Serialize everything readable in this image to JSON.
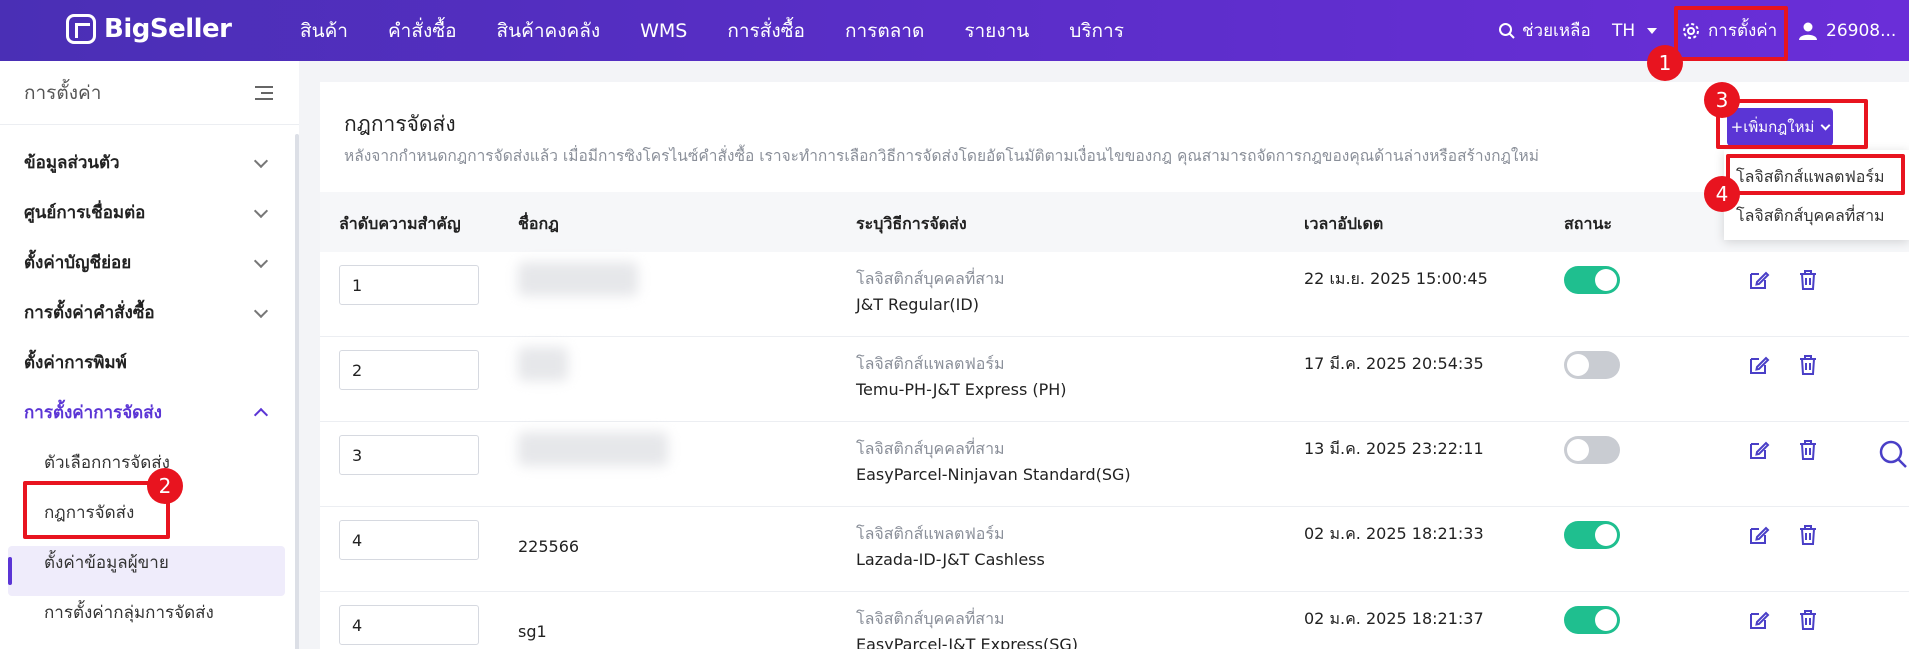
{
  "topbar": {
    "logo": "BigSeller",
    "nav": [
      "สินค้า",
      "คำสั่งซื้อ",
      "สินค้าคงคลัง",
      "WMS",
      "การสั่งซื้อ",
      "การตลาด",
      "รายงาน",
      "บริการ"
    ],
    "help": "ช่วยเหลือ",
    "lang": "TH",
    "settings": "การตั้งค่า",
    "user": "26908..."
  },
  "sidebar": {
    "title": "การตั้งค่า",
    "groups": [
      {
        "label": "ข้อมูลส่วนตัว"
      },
      {
        "label": "ศูนย์การเชื่อมต่อ"
      },
      {
        "label": "ตั้งค่าบัญชีย่อย"
      },
      {
        "label": "การตั้งค่าคำสั่งซื้อ"
      },
      {
        "label": "ตั้งค่าการพิมพ์"
      },
      {
        "label": "การตั้งค่าการจัดส่ง"
      }
    ],
    "subitems": [
      {
        "label": "ตัวเลือกการจัดส่ง"
      },
      {
        "label": "กฎการจัดส่ง"
      },
      {
        "label": "ตั้งค่าข้อมูลผู้ขาย"
      },
      {
        "label": "การตั้งค่ากลุ่มการจัดส่ง"
      }
    ]
  },
  "page": {
    "title": "กฎการจัดส่ง",
    "description": "หลังจากกำหนดกฎการจัดส่งแล้ว เมื่อมีการซิงโครไนซ์คำสั่งซื้อ เราจะทำการเลือกวิธีการจัดส่งโดยอัตโนมัติตามเงื่อนไขของกฎ คุณสามารถจัดการกฎของคุณด้านล่างหรือสร้างกฎใหม่",
    "add_button": "+เพิ่มกฎใหม่"
  },
  "dropdown": {
    "items": [
      "โลจิสติกส์แพลตฟอร์ม",
      "โลจิสติกส์บุคคลที่สาม"
    ]
  },
  "table": {
    "headers": [
      "ลำดับความสำคัญ",
      "ชื่อกฎ",
      "ระบุวิธีการจัดส่ง",
      "เวลาอัปเดต",
      "สถานะ"
    ],
    "rows": [
      {
        "priority": "1",
        "name": "",
        "type": "โลจิสติกส์บุคคลที่สาม",
        "logistics": "J&T Regular(ID)",
        "updated": "22 เม.ย. 2025 15:00:45",
        "enabled": true
      },
      {
        "priority": "2",
        "name": "",
        "type": "โลจิสติกส์แพลตฟอร์ม",
        "logistics": "Temu-PH-J&T Express (PH)",
        "updated": "17 มี.ค. 2025 20:54:35",
        "enabled": false
      },
      {
        "priority": "3",
        "name": "",
        "type": "โลจิสติกส์บุคคลที่สาม",
        "logistics": "EasyParcel-Ninjavan Standard(SG)",
        "updated": "13 มี.ค. 2025 23:22:11",
        "enabled": false
      },
      {
        "priority": "4",
        "name": "225566",
        "type": "โลจิสติกส์แพลตฟอร์ม",
        "logistics": "Lazada-ID-J&T Cashless",
        "updated": "02 ม.ค. 2025 18:21:33",
        "enabled": true
      },
      {
        "priority": "4",
        "name": "sg1",
        "type": "โลจิสติกส์บุคคลที่สาม",
        "logistics": "EasyParcel-J&T Express(SG)",
        "updated": "02 ม.ค. 2025 18:21:37",
        "enabled": true
      }
    ]
  },
  "annotations": [
    "1",
    "2",
    "3",
    "4"
  ],
  "colors": {
    "accent": "#5b35d5",
    "toggle_on": "#1fbf8f",
    "annotation": "#e8141f"
  }
}
